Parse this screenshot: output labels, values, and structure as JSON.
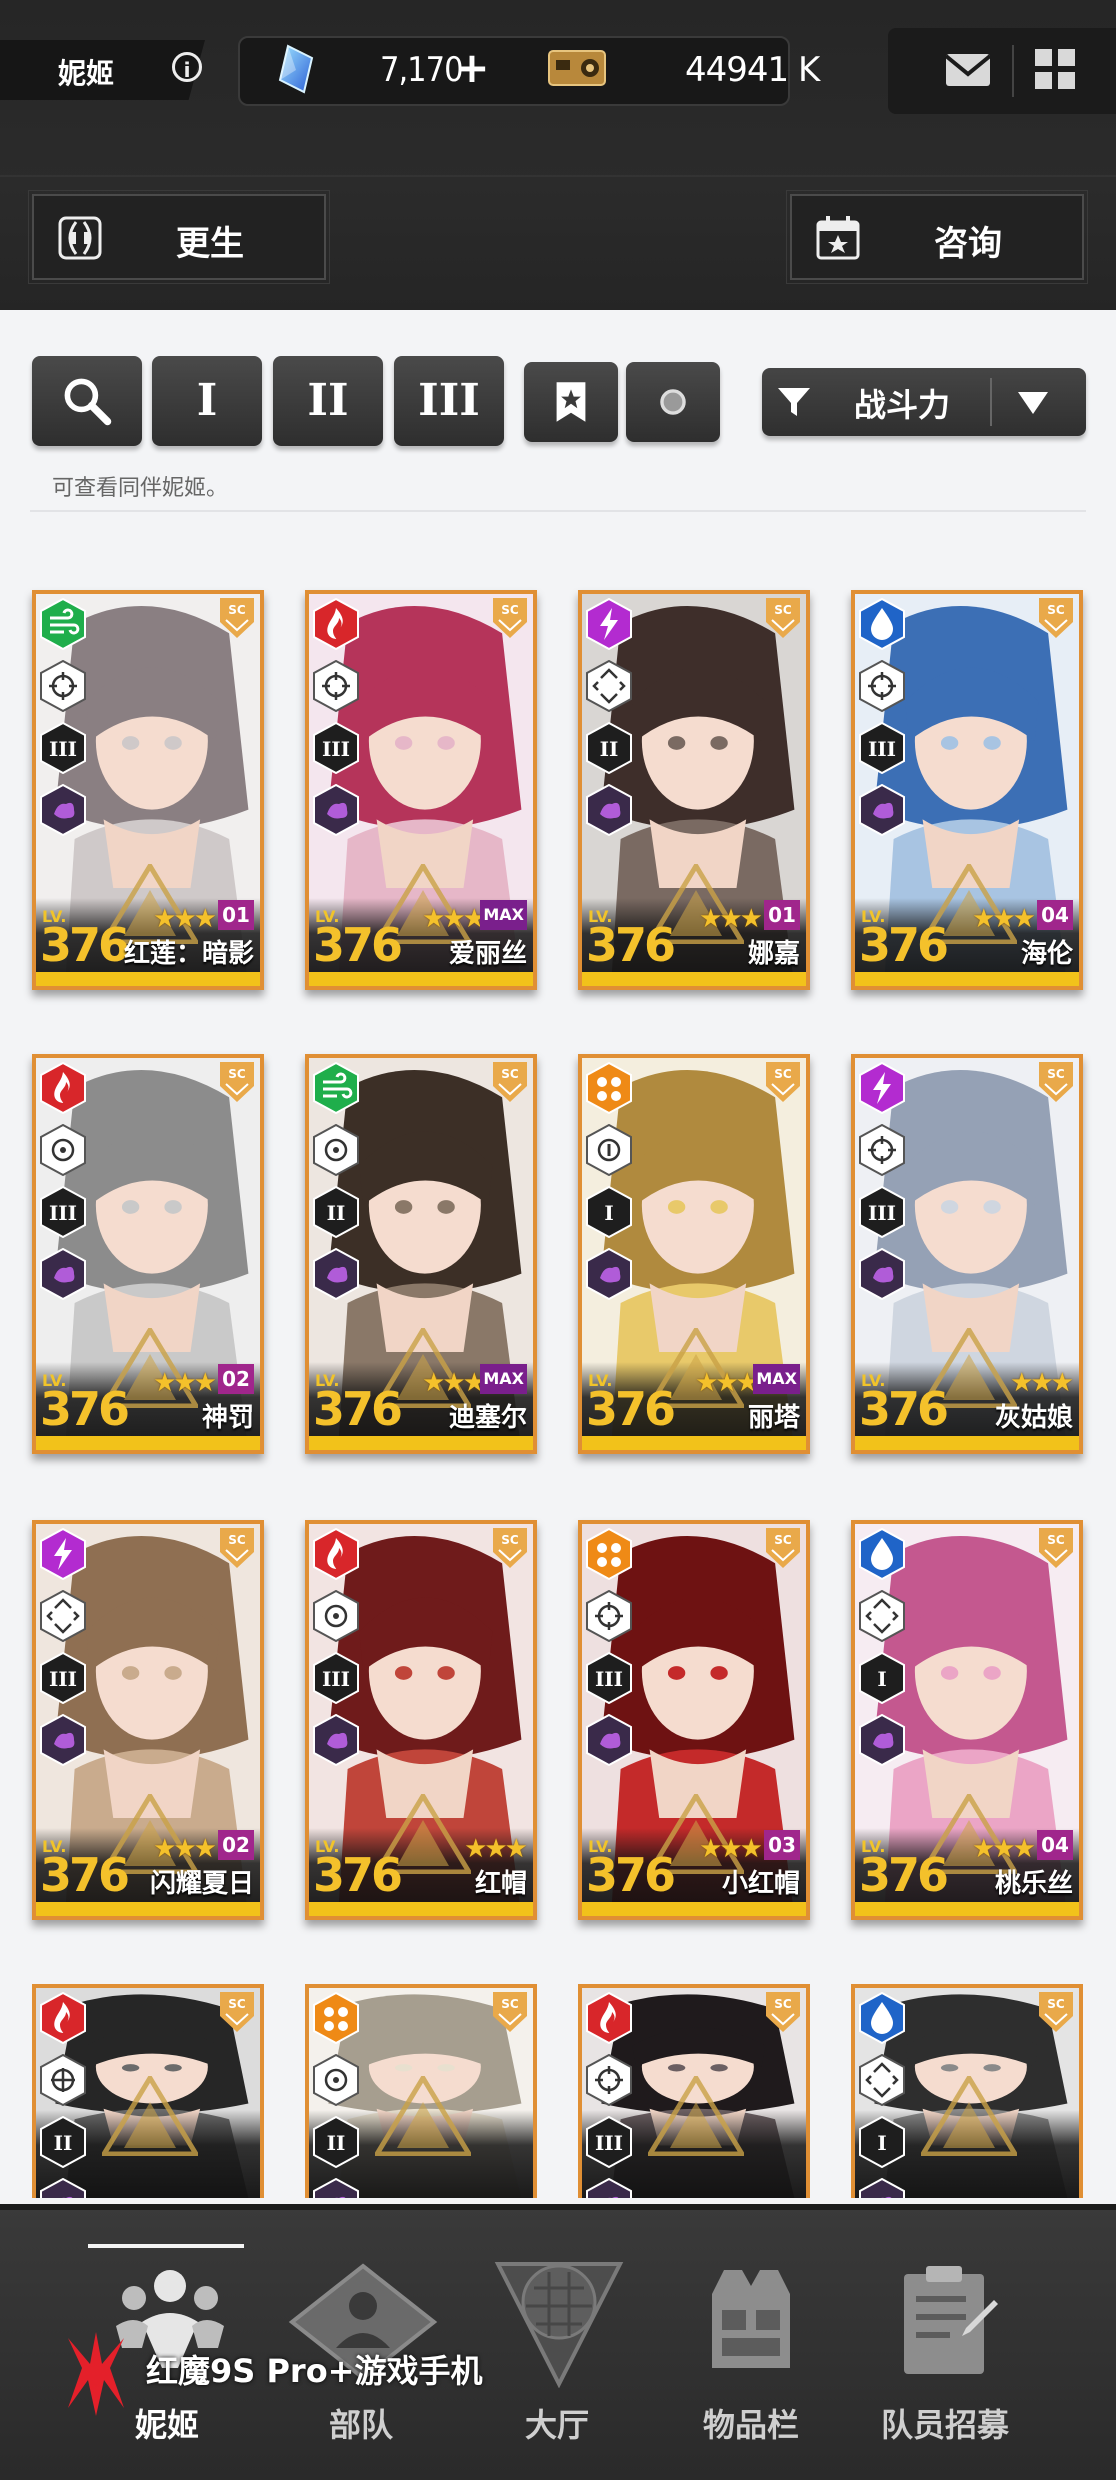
{
  "header": {
    "page_title": "妮姬",
    "currency": {
      "gems": "7,170",
      "credits": "44941 K",
      "plus_label": "+"
    },
    "left_button_label": "更生",
    "right_button_label": "咨询"
  },
  "filters": {
    "buttons": [
      "I",
      "II",
      "III"
    ],
    "sort_label": "战斗力",
    "hint": "可查看同伴妮姬。"
  },
  "characters": [
    {
      "name": "红莲：暗影",
      "level": "376",
      "lv_label": "LV.",
      "core": "01",
      "element": "wind",
      "burst": "III",
      "weapon": "sniper"
    },
    {
      "name": "爱丽丝",
      "level": "376",
      "lv_label": "LV.",
      "core": "MAX",
      "element": "fire",
      "burst": "III",
      "weapon": "sniper"
    },
    {
      "name": "娜嘉",
      "level": "376",
      "lv_label": "LV.",
      "core": "01",
      "element": "electric",
      "burst": "II",
      "weapon": "smg"
    },
    {
      "name": "海伦",
      "level": "376",
      "lv_label": "LV.",
      "core": "04",
      "element": "water",
      "burst": "III",
      "weapon": "sniper"
    },
    {
      "name": "神罚",
      "level": "376",
      "lv_label": "LV.",
      "core": "02",
      "element": "fire",
      "burst": "III",
      "weapon": "ar"
    },
    {
      "name": "迪塞尔",
      "level": "376",
      "lv_label": "LV.",
      "core": "MAX",
      "element": "wind",
      "burst": "II",
      "weapon": "ar"
    },
    {
      "name": "丽塔",
      "level": "376",
      "lv_label": "LV.",
      "core": "MAX",
      "element": "iron",
      "burst": "I",
      "weapon": "rl"
    },
    {
      "name": "灰姑娘",
      "level": "376",
      "lv_label": "LV.",
      "core": "",
      "element": "electric",
      "burst": "III",
      "weapon": "sniper"
    },
    {
      "name": "闪耀夏日",
      "level": "376",
      "lv_label": "LV.",
      "core": "02",
      "element": "electric",
      "burst": "III",
      "weapon": "smg"
    },
    {
      "name": "红帽",
      "level": "376",
      "lv_label": "LV.",
      "core": "",
      "element": "fire",
      "burst": "III",
      "weapon": "ar"
    },
    {
      "name": "小红帽",
      "level": "376",
      "lv_label": "LV.",
      "core": "03",
      "element": "iron",
      "burst": "III",
      "weapon": "sniper"
    },
    {
      "name": "桃乐丝",
      "level": "376",
      "lv_label": "LV.",
      "core": "04",
      "element": "water",
      "burst": "I",
      "weapon": "smg"
    },
    {
      "element": "fire",
      "burst": "II",
      "weapon": "mg"
    },
    {
      "element": "iron",
      "burst": "II",
      "weapon": "ar"
    },
    {
      "element": "fire",
      "burst": "III",
      "weapon": "sniper"
    },
    {
      "element": "water",
      "burst": "I",
      "weapon": "smg"
    }
  ],
  "nav": {
    "items": [
      "妮姬",
      "部队",
      "大厅",
      "物品栏",
      "队员招募"
    ],
    "active": "妮姬"
  },
  "watermark": "红魔9S Pro+游戏手机",
  "colors": {
    "card_border": "#e08f34",
    "level_gold": "#f4c12b",
    "fire": "#d8262a",
    "wind": "#1fae4b",
    "electric": "#b32bd0",
    "water": "#1f64c8",
    "iron": "#ef8a16"
  }
}
